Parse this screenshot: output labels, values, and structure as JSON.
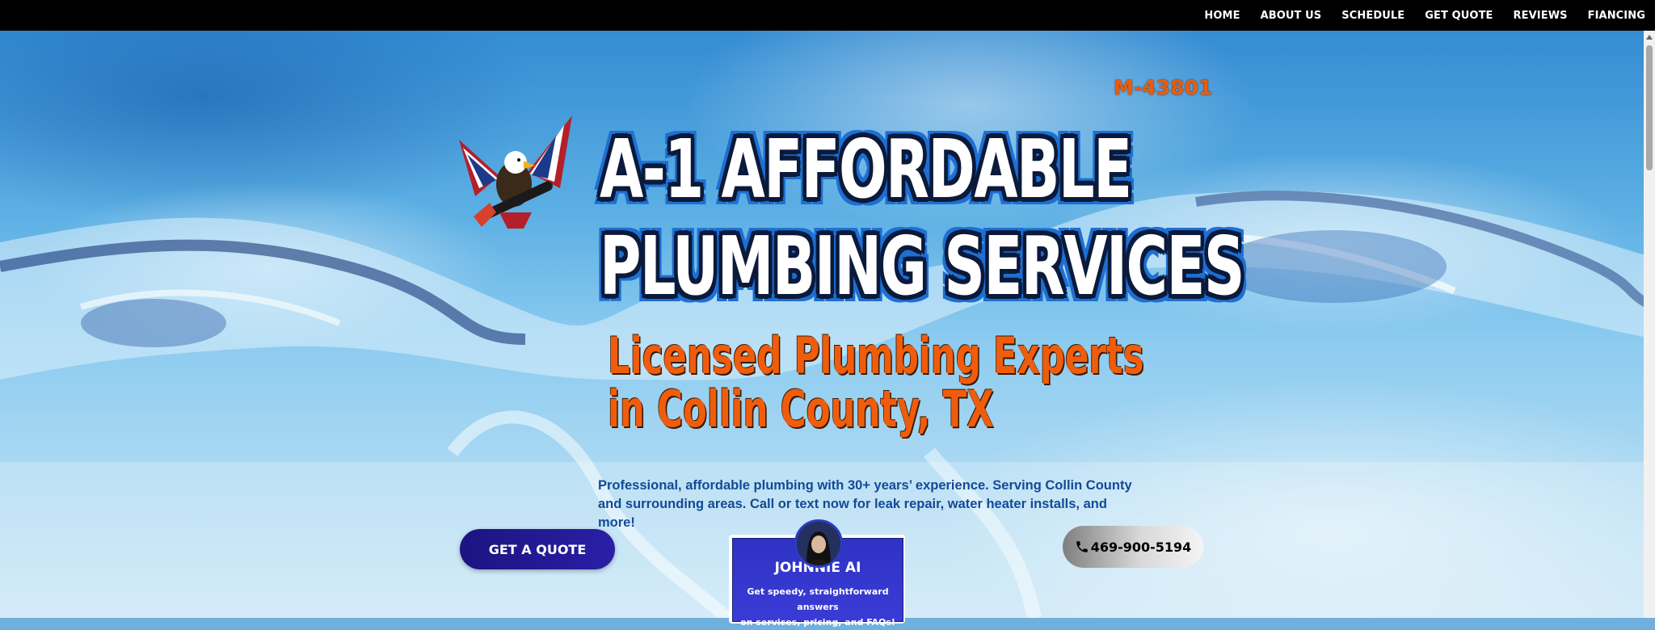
{
  "nav": {
    "items": [
      "HOME",
      "ABOUT US",
      "SCHEDULE",
      "GET QUOTE",
      "REVIEWS",
      "FIANCING"
    ]
  },
  "hero": {
    "license": "M-43801",
    "title_line1": "A-1 AFFORDABLE",
    "title_line2": "PLUMBING SERVICES",
    "subtitle_line1": "Licensed Plumbing Experts",
    "subtitle_line2": "in Collin County, TX",
    "description_line1": "Professional, affordable plumbing with 30+ years’ experience. Serving Collin County",
    "description_line2": "and surrounding areas. Call or text now for leak repair, water heater installs, and more!"
  },
  "actions": {
    "quote_label": "GET A QUOTE",
    "phone_label": "469-900-5194"
  },
  "ai_assistant": {
    "name": "JOHNNIE AI",
    "tagline_line1": "Get speedy, straightforward answers",
    "tagline_line2": "on services, pricing, and FAQs!"
  },
  "icons": {
    "logo": "eagle-wrench-logo",
    "phone": "phone-icon",
    "avatar": "assistant-avatar"
  },
  "colors": {
    "nav_bg": "#000000",
    "accent_orange": "#ef5d0c",
    "quote_button": "#1c1480",
    "ai_card": "#3a3bd6",
    "description_text": "#134a96"
  }
}
